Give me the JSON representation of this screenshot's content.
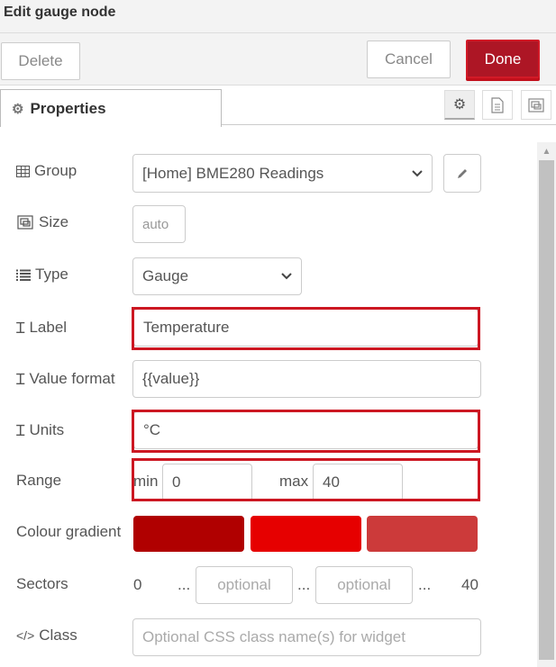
{
  "header": {
    "title": "Edit gauge node"
  },
  "toolbar": {
    "delete_label": "Delete",
    "cancel_label": "Cancel",
    "done_label": "Done"
  },
  "tabs": {
    "properties_label": "Properties",
    "icons": [
      "gear-icon",
      "description-icon",
      "appearance-icon"
    ]
  },
  "form": {
    "group": {
      "label": "Group",
      "value": "[Home] BME280 Readings"
    },
    "size": {
      "label": "Size",
      "value": "auto"
    },
    "type": {
      "label": "Type",
      "value": "Gauge"
    },
    "label": {
      "label": "Label",
      "value": "Temperature"
    },
    "value_format": {
      "label": "Value format",
      "value": "{{value}}"
    },
    "units": {
      "label": "Units",
      "value": "°C"
    },
    "range": {
      "label": "Range",
      "min_label": "min",
      "min_value": "0",
      "max_label": "max",
      "max_value": "40"
    },
    "colour_gradient": {
      "label": "Colour gradient",
      "colors": [
        "#b00000",
        "#e60000",
        "#cc3a3a"
      ]
    },
    "sectors": {
      "label": "Sectors",
      "start": "0",
      "sep": "...",
      "placeholder1": "optional",
      "placeholder2": "optional",
      "end": "40"
    },
    "class": {
      "label": "Class",
      "placeholder": "Optional CSS class name(s) for widget"
    }
  },
  "colors": {
    "accent": "#ad1625",
    "highlight": "#cc1722"
  }
}
